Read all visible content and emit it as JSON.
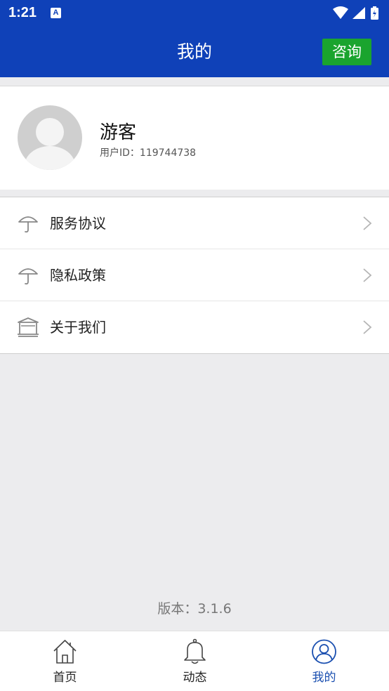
{
  "status_bar": {
    "time": "1:21",
    "notification_icon_letter": "A"
  },
  "header": {
    "title": "我的",
    "consult_label": "咨询"
  },
  "profile": {
    "username": "游客",
    "user_id_text": "用户ID：119744738"
  },
  "menu": {
    "items": [
      {
        "label": "服务协议",
        "icon": "umbrella-icon"
      },
      {
        "label": "隐私政策",
        "icon": "umbrella-icon"
      },
      {
        "label": "关于我们",
        "icon": "building-icon"
      }
    ]
  },
  "version_text": "版本：3.1.6",
  "bottom_nav": {
    "items": [
      {
        "label": "首页",
        "icon": "home-icon",
        "active": false
      },
      {
        "label": "动态",
        "icon": "bell-icon",
        "active": false
      },
      {
        "label": "我的",
        "icon": "user-icon",
        "active": true
      }
    ]
  },
  "colors": {
    "primary": "#0f41b8",
    "consult_button": "#1aa42e",
    "background": "#ececee",
    "active_nav": "#1a4fb0"
  }
}
